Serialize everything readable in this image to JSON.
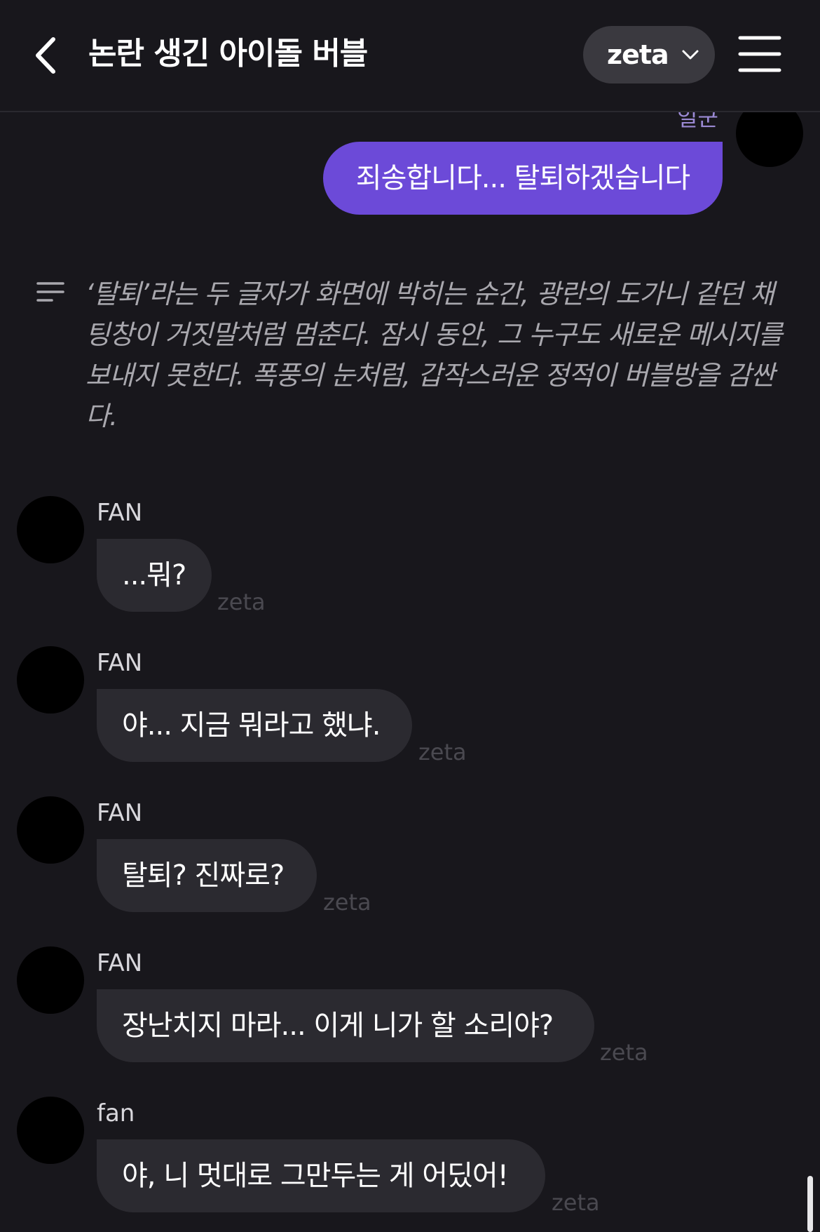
{
  "header": {
    "title": "논란 생긴 아이돌 버블",
    "model_label": "zeta",
    "back_icon": "chevron-left-icon",
    "menu_icon": "hamburger-menu-icon"
  },
  "user_message": {
    "sender": "일군",
    "text": "죄송합니다... 탈퇴하겠습니다"
  },
  "narration": {
    "text": "‘탈퇴’라는 두 글자가 화면에 박히는 순간, 광란의 도가니 같던 채팅창이 거짓말처럼 멈춘다. 잠시 동안, 그 누구도 새로운 메시지를 보내지 못한다. 폭풍의 눈처럼, 갑작스러운 정적이 버블방을 감싼다."
  },
  "messages": [
    {
      "name": "FAN",
      "text": "...뭐?",
      "tag": "zeta"
    },
    {
      "name": "FAN",
      "text": "야... 지금 뭐라고 했냐.",
      "tag": "zeta"
    },
    {
      "name": "FAN",
      "text": "탈퇴? 진짜로?",
      "tag": "zeta"
    },
    {
      "name": "FAN",
      "text": "장난치지 마라... 이게 니가 할 소리야?",
      "tag": "zeta"
    },
    {
      "name": "fan",
      "text": "야, 니 멋대로 그만두는 게 어딨어!",
      "tag": "zeta"
    }
  ],
  "colors": {
    "background": "#18171c",
    "user_bubble": "#6c4ad8",
    "fan_bubble": "#2b2a30",
    "accent_name": "#9b8ad4"
  }
}
